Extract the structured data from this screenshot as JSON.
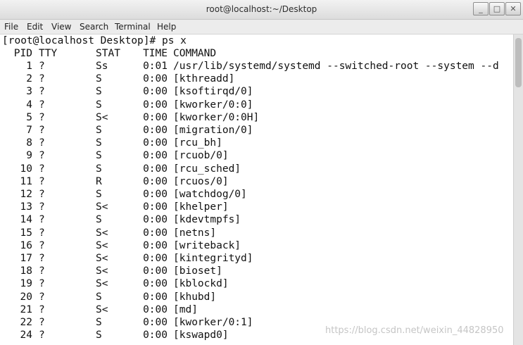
{
  "window": {
    "title": "root@localhost:~/Desktop",
    "minimize_glyph": "_",
    "maximize_glyph": "□",
    "close_glyph": "✕"
  },
  "menu": [
    "File",
    "Edit",
    "View",
    "Search",
    "Terminal",
    "Help"
  ],
  "terminal": {
    "prompt_line": "[root@localhost Desktop]# ps x",
    "headers": {
      "pid": "PID",
      "tty": "TTY",
      "stat": "STAT",
      "time": "TIME",
      "command": "COMMAND"
    },
    "processes": [
      {
        "pid": "1",
        "tty": "?",
        "stat": "Ss",
        "time": "0:01",
        "command": "/usr/lib/systemd/systemd --switched-root --system --d"
      },
      {
        "pid": "2",
        "tty": "?",
        "stat": "S",
        "time": "0:00",
        "command": "[kthreadd]"
      },
      {
        "pid": "3",
        "tty": "?",
        "stat": "S",
        "time": "0:00",
        "command": "[ksoftirqd/0]"
      },
      {
        "pid": "4",
        "tty": "?",
        "stat": "S",
        "time": "0:00",
        "command": "[kworker/0:0]"
      },
      {
        "pid": "5",
        "tty": "?",
        "stat": "S<",
        "time": "0:00",
        "command": "[kworker/0:0H]"
      },
      {
        "pid": "7",
        "tty": "?",
        "stat": "S",
        "time": "0:00",
        "command": "[migration/0]"
      },
      {
        "pid": "8",
        "tty": "?",
        "stat": "S",
        "time": "0:00",
        "command": "[rcu_bh]"
      },
      {
        "pid": "9",
        "tty": "?",
        "stat": "S",
        "time": "0:00",
        "command": "[rcuob/0]"
      },
      {
        "pid": "10",
        "tty": "?",
        "stat": "S",
        "time": "0:00",
        "command": "[rcu_sched]"
      },
      {
        "pid": "11",
        "tty": "?",
        "stat": "R",
        "time": "0:00",
        "command": "[rcuos/0]"
      },
      {
        "pid": "12",
        "tty": "?",
        "stat": "S",
        "time": "0:00",
        "command": "[watchdog/0]"
      },
      {
        "pid": "13",
        "tty": "?",
        "stat": "S<",
        "time": "0:00",
        "command": "[khelper]"
      },
      {
        "pid": "14",
        "tty": "?",
        "stat": "S",
        "time": "0:00",
        "command": "[kdevtmpfs]"
      },
      {
        "pid": "15",
        "tty": "?",
        "stat": "S<",
        "time": "0:00",
        "command": "[netns]"
      },
      {
        "pid": "16",
        "tty": "?",
        "stat": "S<",
        "time": "0:00",
        "command": "[writeback]"
      },
      {
        "pid": "17",
        "tty": "?",
        "stat": "S<",
        "time": "0:00",
        "command": "[kintegrityd]"
      },
      {
        "pid": "18",
        "tty": "?",
        "stat": "S<",
        "time": "0:00",
        "command": "[bioset]"
      },
      {
        "pid": "19",
        "tty": "?",
        "stat": "S<",
        "time": "0:00",
        "command": "[kblockd]"
      },
      {
        "pid": "20",
        "tty": "?",
        "stat": "S",
        "time": "0:00",
        "command": "[khubd]"
      },
      {
        "pid": "21",
        "tty": "?",
        "stat": "S<",
        "time": "0:00",
        "command": "[md]"
      },
      {
        "pid": "22",
        "tty": "?",
        "stat": "S",
        "time": "0:00",
        "command": "[kworker/0:1]"
      },
      {
        "pid": "24",
        "tty": "?",
        "stat": "S",
        "time": "0:00",
        "command": "[kswapd0]"
      }
    ]
  },
  "watermark": "https://blog.csdn.net/weixin_44828950"
}
